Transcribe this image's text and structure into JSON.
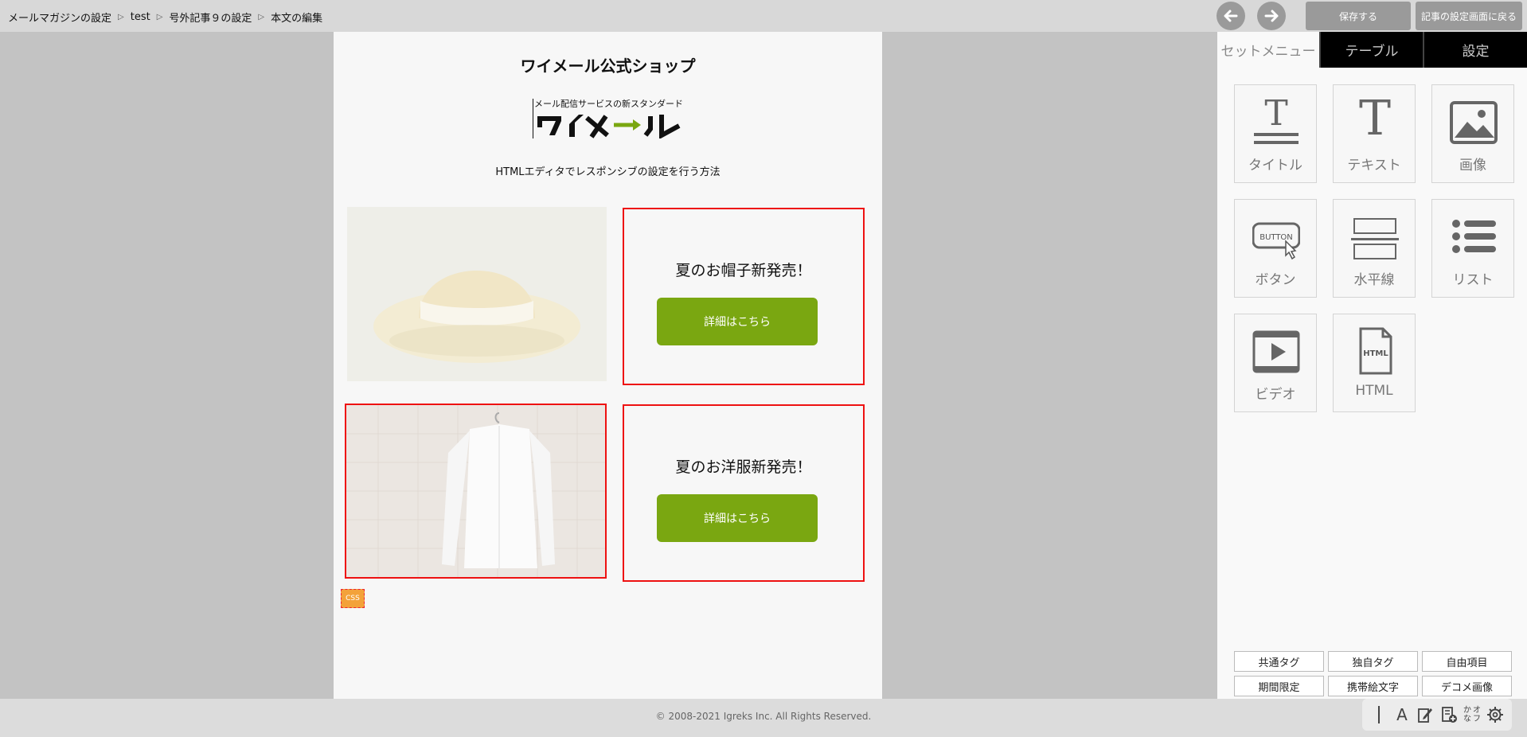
{
  "breadcrumb": [
    "メールマガジンの設定",
    "test",
    "号外記事９の設定",
    "本文の編集"
  ],
  "header": {
    "save_label": "保存する",
    "back_label": "記事の設定画面に戻る"
  },
  "canvas": {
    "shop_title": "ワイメール公式ショップ",
    "logo": {
      "tagline": "メール配信サービスの新スタンダード"
    },
    "intro_text": "HTMLエディタでレスポンシブの設定を行う方法",
    "promos": [
      {
        "text": "夏のお帽子新発売！",
        "button": "詳細はこちら"
      },
      {
        "text": "夏のお洋服新発売！",
        "button": "詳細はこちら"
      }
    ],
    "css_badge": "CSS"
  },
  "panel": {
    "tabs": [
      "セットメニュー",
      "テーブル",
      "設定"
    ],
    "tools": [
      {
        "label": "タイトル",
        "icon": "title-icon"
      },
      {
        "label": "テキスト",
        "icon": "text-icon"
      },
      {
        "label": "画像",
        "icon": "image-icon"
      },
      {
        "label": "ボタン",
        "icon": "button-icon",
        "icon_text": "BUTTON"
      },
      {
        "label": "水平線",
        "icon": "horizontal-line-icon"
      },
      {
        "label": "リスト",
        "icon": "list-icon"
      },
      {
        "label": "ビデオ",
        "icon": "video-icon"
      },
      {
        "label": "HTML",
        "icon": "html-file-icon",
        "icon_text": "HTML"
      }
    ],
    "tags": [
      "共通タグ",
      "独自タグ",
      "自由項目",
      "期間限定",
      "携帯絵文字",
      "デコメ画像"
    ]
  },
  "mini_toolbar": {
    "font_glyph": "A",
    "kana_line1": "かな",
    "kana_line2": "オフ"
  },
  "footer": {
    "copyright": "© 2008-2021 Igreks Inc. All Rights Reserved."
  },
  "colors": {
    "accent_green": "#7aa711",
    "selection_red": "#ee1111"
  }
}
